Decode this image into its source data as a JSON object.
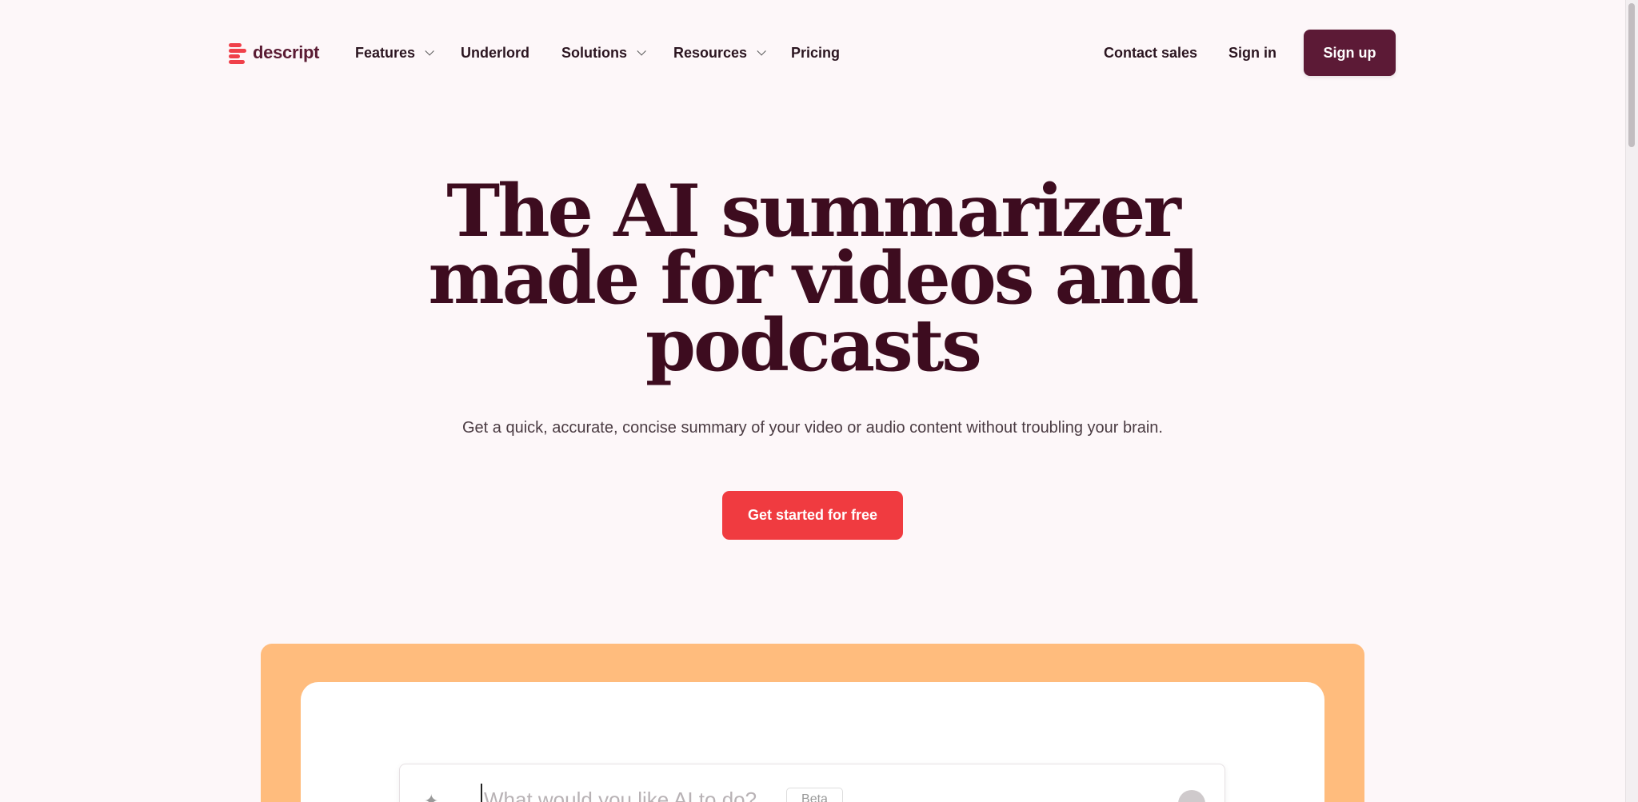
{
  "brand": {
    "name": "descript",
    "accent": "#f0404a",
    "primary": "#5c1a36"
  },
  "nav": {
    "features": "Features",
    "underlord": "Underlord",
    "solutions": "Solutions",
    "resources": "Resources",
    "pricing": "Pricing",
    "contact_sales": "Contact sales",
    "sign_in": "Sign in",
    "sign_up": "Sign up"
  },
  "hero": {
    "title_line1": "The AI summarizer",
    "title_line2": "made for videos and",
    "title_line3": "podcasts",
    "subtitle": "Get a quick, accurate, concise summary of your video or audio content without troubling your brain.",
    "cta": "Get started for free"
  },
  "demo": {
    "prompt_placeholder": "What would you like AI to do?",
    "beta_label": "Beta",
    "frame_color": "#ffbc7d"
  },
  "icons": [
    "descript-logo-icon",
    "chevron-down-icon",
    "sparkle-icon",
    "send-icon"
  ]
}
